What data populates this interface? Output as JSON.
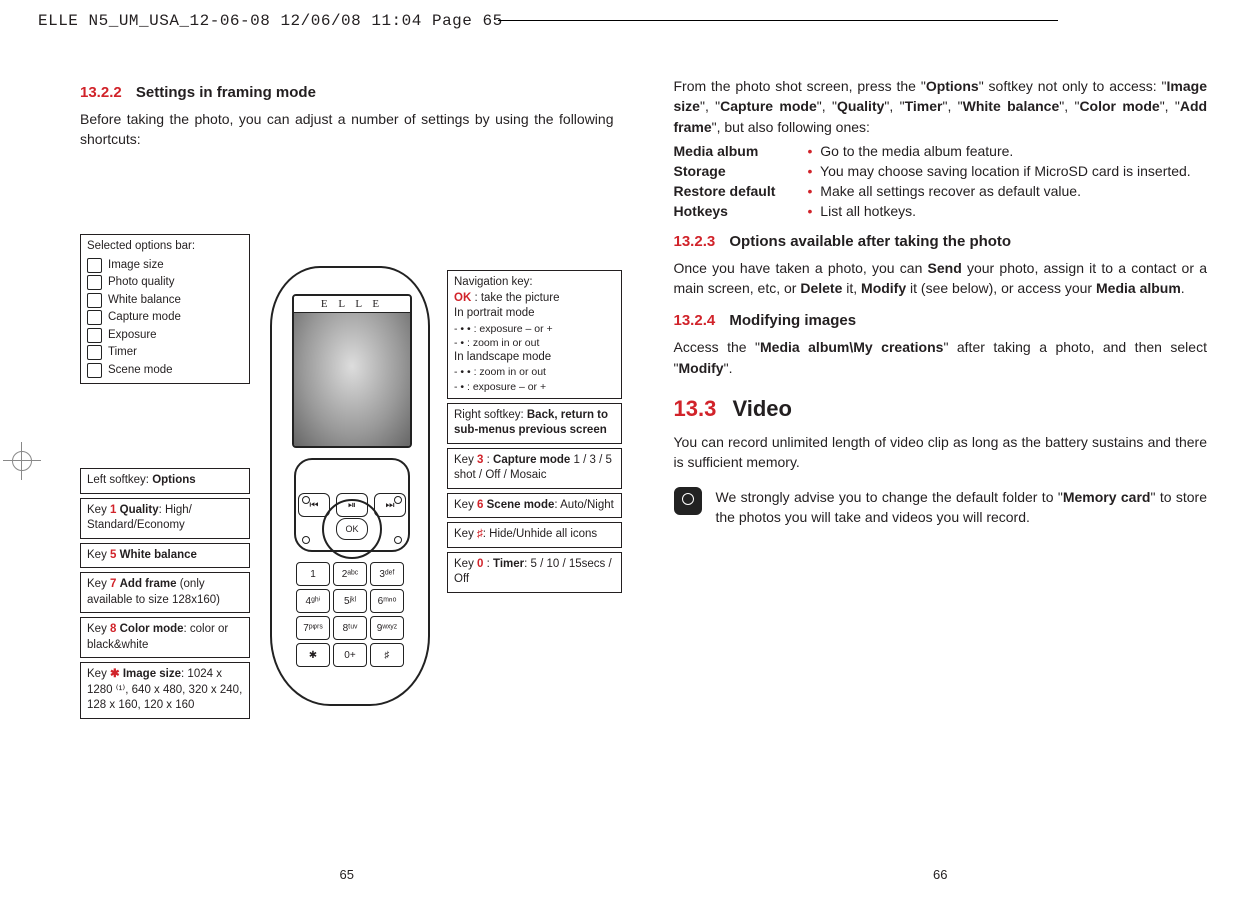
{
  "print_header": "ELLE N5_UM_USA_12-06-08  12/06/08  11:04  Page 65",
  "left_page": {
    "sec_1322_num": "13.2.2",
    "sec_1322_title": "Settings in framing mode",
    "intro": "Before taking the photo, you can adjust a number of settings by using the following shortcuts:",
    "options_bar_header": "Selected options bar:",
    "options_bar_items": [
      "Image size",
      "Photo quality",
      "White balance",
      "Capture mode",
      "Exposure",
      "Timer",
      "Scene mode"
    ],
    "left_softkey": {
      "label": "Left softkey: ",
      "value": "Options"
    },
    "key1": {
      "glyph": "1",
      "bold": "Quality",
      "rest": ": High/ Standard/Economy"
    },
    "key5": {
      "glyph": "5",
      "bold": "White balance",
      "rest": ""
    },
    "key7": {
      "glyph": "7",
      "bold": "Add frame",
      "rest": " (only available to size 128x160)"
    },
    "key8": {
      "glyph": "8",
      "bold": "Color mode",
      "rest": ": color or black&white"
    },
    "keystar": {
      "glyph": "✱",
      "bold": "Image size",
      "rest": ": 1024 x 1280 ⁽¹⁾, 640 x 480, 320 x 240, 128 x 160, 120 x 160"
    },
    "nav_header": "Navigation key:",
    "nav_ok": {
      "ok": "OK",
      "rest": " : take the picture"
    },
    "nav_portrait_hdr": "In portrait mode",
    "nav_portrait_1": "-   • • : exposure – or +",
    "nav_portrait_2": "-   •  : zoom in or out",
    "nav_landscape_hdr": "In landscape mode",
    "nav_landscape_1": "-   • • : zoom in or out",
    "nav_landscape_2": "-   •  : exposure – or +",
    "right_softkey": {
      "label": "Right softkey: ",
      "value": "Back, return to sub-menus previous screen"
    },
    "key3": {
      "glyph": "3",
      "bold": "Capture mode",
      "rest": " 1 / 3 / 5 shot / Off / Mosaic"
    },
    "key6": {
      "glyph": "6",
      "bold": "Scene mode",
      "rest": ": Auto/Night"
    },
    "keyhash": {
      "glyph": "♯",
      "rest": ": Hide/Unhide all icons"
    },
    "key0": {
      "glyph": "0",
      "bold": "Timer",
      "rest": ": 5 / 10 / 15secs / Off"
    },
    "phone_brand": "E L L E",
    "keys": [
      "1",
      "2ᵃᵇᶜ",
      "3ᵈᵉᶠ",
      "4ᵍʰⁱ",
      "5ʲᵏˡ",
      "6ᵐⁿᵒ",
      "7ᵖᵠʳˢ",
      "8ᵗᵘᵛ",
      "9ʷˣʸᶻ",
      "✱",
      "0+",
      "♯"
    ],
    "page_num": "65"
  },
  "right_page": {
    "para1_pre": "From the photo shot screen, press the \"",
    "para1_b1": "Options",
    "para1_mid1": "\" softkey not only to access: \"",
    "para1_b2": "Image size",
    "para1_mid2": "\", \"",
    "para1_b3": "Capture mode",
    "para1_mid3": "\", \"",
    "para1_b4": "Quality",
    "para1_mid4": "\", \"",
    "para1_b5": "Timer",
    "para1_mid5": "\", \"",
    "para1_b6": "White balance",
    "para1_mid6": "\", \"",
    "para1_b7": "Color mode",
    "para1_mid7": "\", \"",
    "para1_b8": "Add frame",
    "para1_post": "\", but also following ones:",
    "defs": [
      {
        "term": "Media album",
        "desc": "Go to the media album feature."
      },
      {
        "term": "Storage",
        "desc": "You may choose saving location if MicroSD card is inserted."
      },
      {
        "term": "Restore default",
        "desc": "Make all settings recover as default value."
      },
      {
        "term": "Hotkeys",
        "desc": "List all hotkeys."
      }
    ],
    "sec_1323_num": "13.2.3",
    "sec_1323_title": "Options available after taking the photo",
    "para2_pre": "Once you have taken a photo, you can ",
    "para2_b1": "Send",
    "para2_mid1": " your photo, assign it to a contact or a main screen, etc, or ",
    "para2_b2": "Delete",
    "para2_mid2": " it, ",
    "para2_b3": "Modify",
    "para2_mid3": " it (see below), or access your ",
    "para2_b4": "Media album",
    "para2_post": ".",
    "sec_1324_num": "13.2.4",
    "sec_1324_title": "Modifying images",
    "para3_pre": "Access the \"",
    "para3_b1": "Media album\\My creations",
    "para3_mid": "\" after taking a photo, and then select \"",
    "para3_b2": "Modify",
    "para3_post": "\".",
    "sec_133_num": "13.3",
    "sec_133_title": "Video",
    "para4": "You can record unlimited length of video clip as long as the battery sustains and there is sufficient memory.",
    "tip_pre": "We strongly advise you to change the default folder to \"",
    "tip_b": "Memory card",
    "tip_post": "\" to store the photos you will take and videos you will record.",
    "page_num": "66"
  }
}
